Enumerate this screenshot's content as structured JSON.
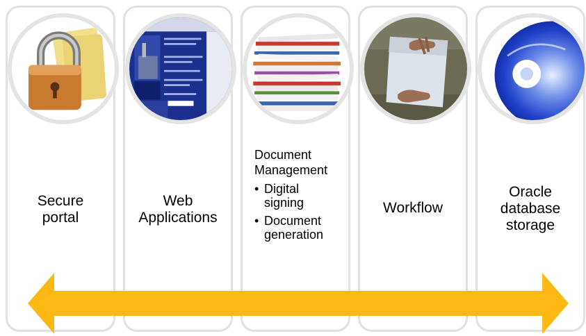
{
  "panels": [
    {
      "id": "secure-portal",
      "label": "Secure\nportal"
    },
    {
      "id": "web-applications",
      "label": "Web\nApplications"
    },
    {
      "id": "document-management",
      "title": "Document\nManagement",
      "bullets": [
        "Digital\nsigning",
        "Document\ngeneration"
      ]
    },
    {
      "id": "workflow",
      "label": "Workflow"
    },
    {
      "id": "oracle-storage",
      "label": "Oracle\ndatabase\nstorage"
    }
  ],
  "colors": {
    "arrow": "#fdb913",
    "panel_border": "#e1e1e1"
  },
  "icons": [
    "padlock-folder-image",
    "oil-and-gas-website-image",
    "document-stack-image",
    "hands-on-paper-image",
    "cd-disc-image"
  ]
}
